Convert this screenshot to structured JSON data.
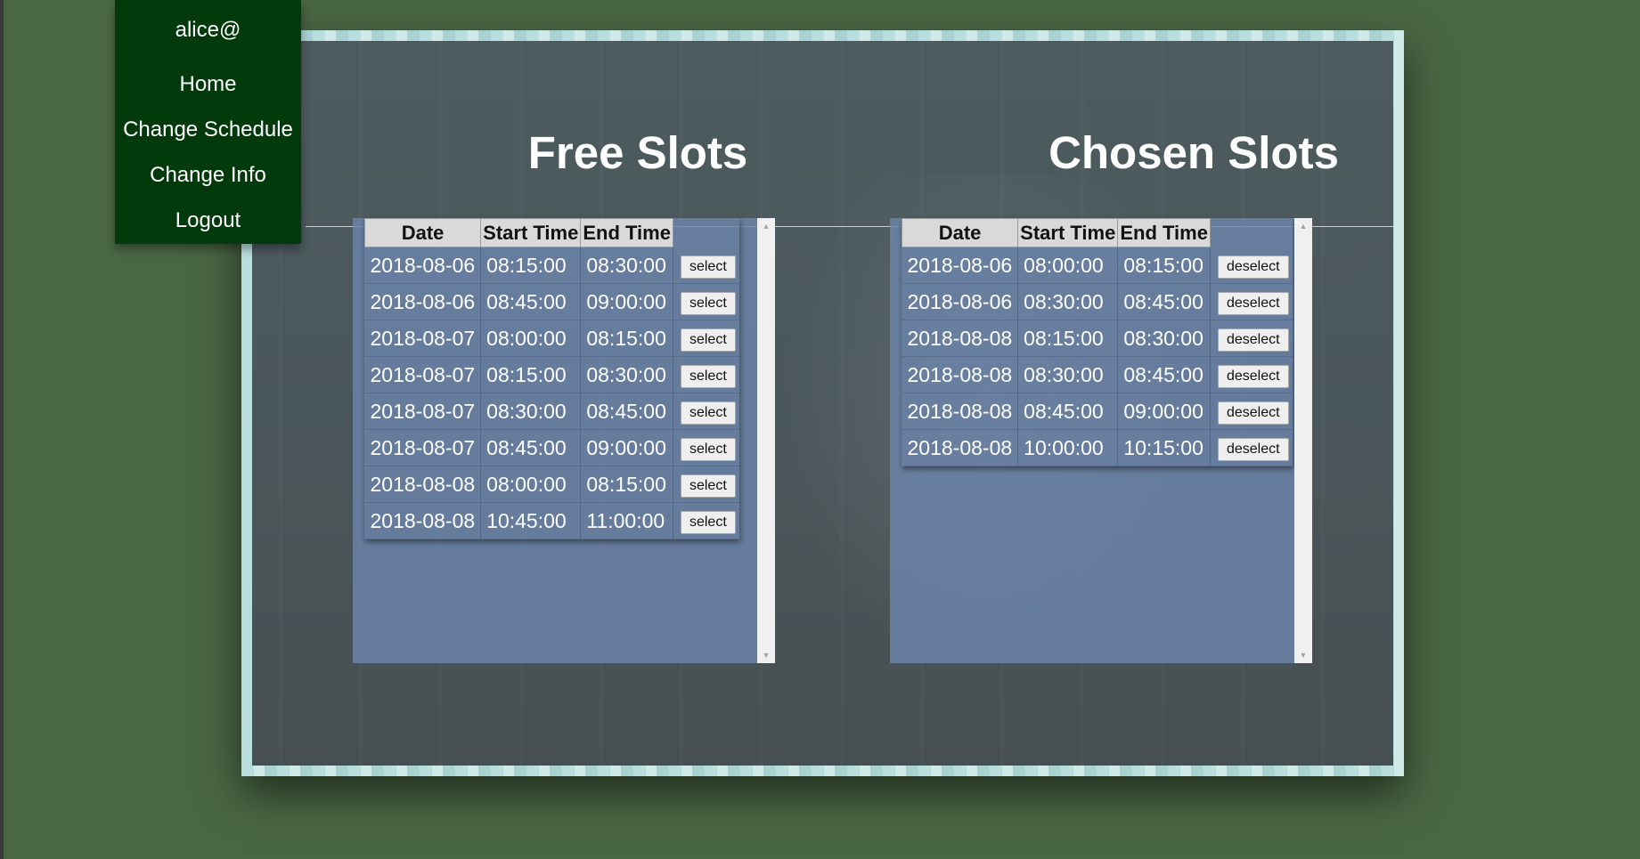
{
  "nav": {
    "user": "alice@",
    "items": [
      {
        "label": "Home"
      },
      {
        "label": "Change Schedule"
      },
      {
        "label": "Change Info"
      },
      {
        "label": "Logout"
      }
    ]
  },
  "free": {
    "title": "Free Slots",
    "columns": [
      "Date",
      "Start Time",
      "End Time"
    ],
    "button_label": "select",
    "rows": [
      {
        "date": "2018-08-06",
        "start": "08:15:00",
        "end": "08:30:00"
      },
      {
        "date": "2018-08-06",
        "start": "08:45:00",
        "end": "09:00:00"
      },
      {
        "date": "2018-08-07",
        "start": "08:00:00",
        "end": "08:15:00"
      },
      {
        "date": "2018-08-07",
        "start": "08:15:00",
        "end": "08:30:00"
      },
      {
        "date": "2018-08-07",
        "start": "08:30:00",
        "end": "08:45:00"
      },
      {
        "date": "2018-08-07",
        "start": "08:45:00",
        "end": "09:00:00"
      },
      {
        "date": "2018-08-08",
        "start": "08:00:00",
        "end": "08:15:00"
      },
      {
        "date": "2018-08-08",
        "start": "10:45:00",
        "end": "11:00:00"
      }
    ]
  },
  "chosen": {
    "title": "Chosen Slots",
    "columns": [
      "Date",
      "Start Time",
      "End Time"
    ],
    "button_label": "deselect",
    "rows": [
      {
        "date": "2018-08-06",
        "start": "08:00:00",
        "end": "08:15:00"
      },
      {
        "date": "2018-08-06",
        "start": "08:30:00",
        "end": "08:45:00"
      },
      {
        "date": "2018-08-08",
        "start": "08:15:00",
        "end": "08:30:00"
      },
      {
        "date": "2018-08-08",
        "start": "08:30:00",
        "end": "08:45:00"
      },
      {
        "date": "2018-08-08",
        "start": "08:45:00",
        "end": "09:00:00"
      },
      {
        "date": "2018-08-08",
        "start": "10:00:00",
        "end": "10:15:00"
      }
    ]
  },
  "icons": {
    "scroll_up": "scroll-up-arrow-icon",
    "scroll_down": "scroll-down-arrow-icon"
  },
  "colors": {
    "page_background": "#4a6744",
    "nav_background": "#023a0b",
    "panel_background": "#4d5b60",
    "slot_box_background": "#6c85ac"
  }
}
